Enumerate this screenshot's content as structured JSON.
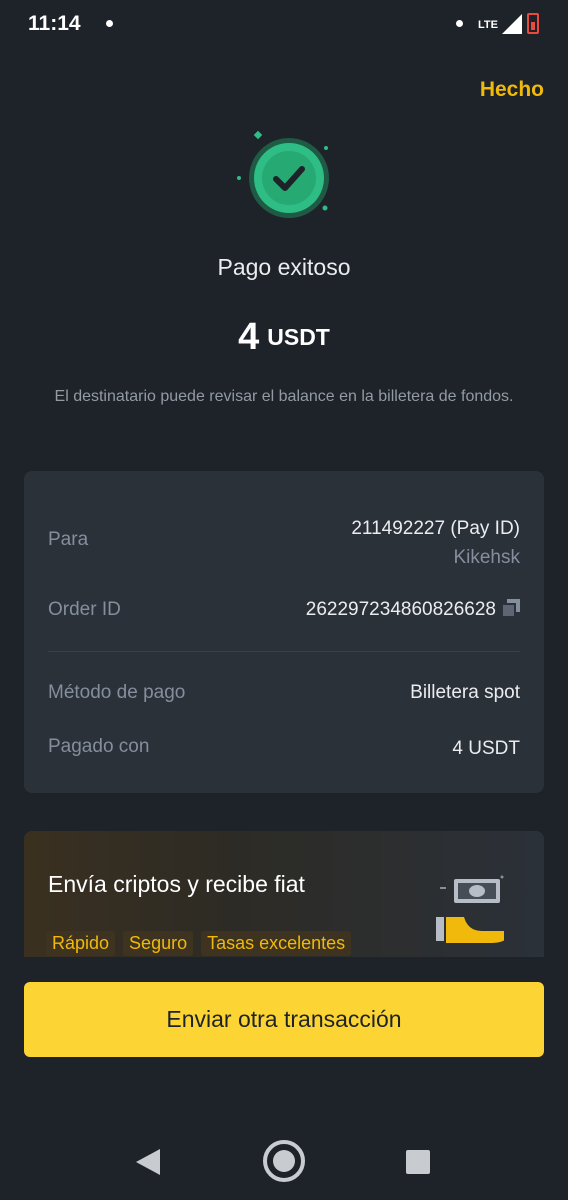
{
  "status_bar": {
    "time": "11:14",
    "network": "LTE"
  },
  "header": {
    "done_label": "Hecho"
  },
  "result": {
    "title": "Pago exitoso",
    "amount_value": "4",
    "amount_currency": "USDT",
    "description": "El destinatario puede revisar el balance en la billetera de fondos."
  },
  "details": {
    "to_label": "Para",
    "to_value": "211492227 (Pay ID)",
    "to_name": "Kikehsk",
    "order_label": "Order ID",
    "order_value": "262297234860826628",
    "method_label": "Método de pago",
    "method_value": "Billetera spot",
    "paid_label": "Pagado con",
    "paid_value": "4 USDT"
  },
  "promo": {
    "title": "Envía criptos y recibe fiat",
    "tags": [
      "Rápido",
      "Seguro",
      "Tasas excelentes"
    ]
  },
  "actions": {
    "primary_label": "Enviar otra transacción"
  },
  "colors": {
    "accent": "#f0b90b",
    "button": "#fcd535",
    "success": "#2ebd85",
    "background": "#1e2329",
    "card": "#2b3139"
  }
}
